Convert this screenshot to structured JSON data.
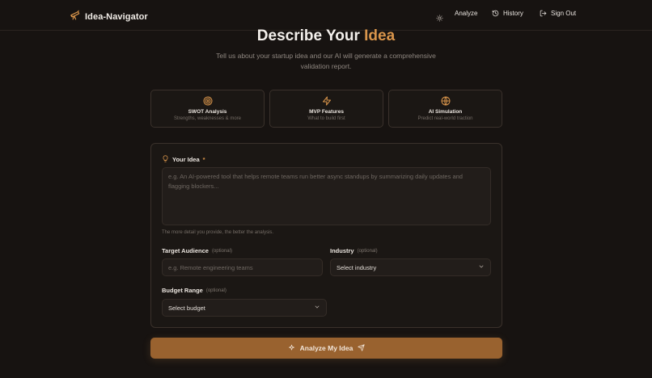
{
  "nav": {
    "brand": "Idea-Navigator",
    "analyze": "Analyze",
    "history": "History",
    "sign_out": "Sign Out"
  },
  "hero": {
    "title_prefix": "Describe Your ",
    "title_accent": "Idea",
    "subtitle": "Tell us about your startup idea and our AI will generate a comprehensive validation report."
  },
  "features": [
    {
      "icon": "target-icon",
      "title": "SWOT Analysis",
      "subtitle": "Strengths, weaknesses & more"
    },
    {
      "icon": "zap-icon",
      "title": "MVP Features",
      "subtitle": "What to build first"
    },
    {
      "icon": "globe-icon",
      "title": "AI Simulation",
      "subtitle": "Predict real-world traction"
    }
  ],
  "form": {
    "idea_label": "Your Idea",
    "idea_required": "*",
    "idea_placeholder": "e.g. An AI-powered tool that helps remote teams run better async standups by summarizing daily updates and flagging blockers...",
    "idea_hint": "The more detail you provide, the better the analysis.",
    "audience_label": "Target Audience",
    "audience_optional": "(optional)",
    "audience_placeholder": "e.g. Remote engineering teams",
    "industry_label": "Industry",
    "industry_optional": "(optional)",
    "industry_value": "Select industry",
    "budget_label": "Budget Range",
    "budget_optional": "(optional)",
    "budget_value": "Select budget"
  },
  "cta": {
    "label": "Analyze My Idea"
  },
  "colors": {
    "accent": "#d9954b",
    "background": "#171311",
    "cta": "#99622f"
  }
}
